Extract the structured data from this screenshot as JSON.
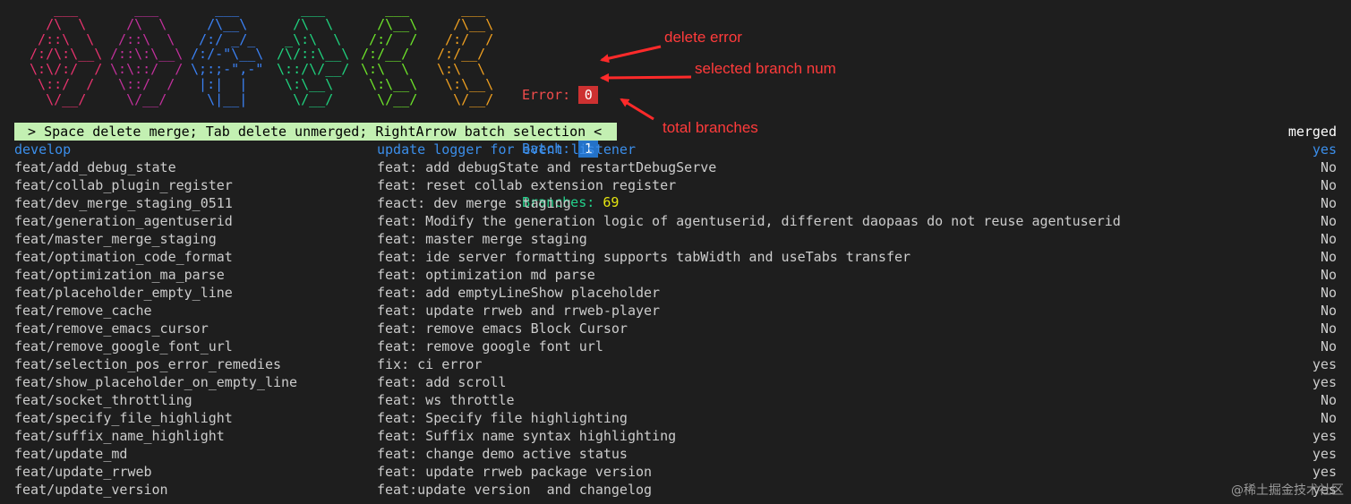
{
  "logo": {
    "columns": [
      {
        "color": "#e8336e",
        "lines": [
          "    ___   ",
          "   /\\  \\  ",
          "  /::\\  \\ ",
          " /:/\\:\\__\\",
          " \\:\\/:/  /",
          "  \\::/  / ",
          "   \\/__/  "
        ]
      },
      {
        "color": "#c2309c",
        "lines": [
          "    ___   ",
          "   /\\  \\  ",
          "  /::\\  \\ ",
          " /::\\:\\__\\",
          " \\:\\::/  /",
          "  \\::/  / ",
          "   \\/__/  "
        ]
      },
      {
        "color": "#3b82f6",
        "lines": [
          "    ___   ",
          "   /\\__\\  ",
          "  /:/ _/_ ",
          " /:/-\"\\__\\",
          " \\;:;-\",-\"",
          "  |:|  |  ",
          "   \\|__|  "
        ]
      },
      {
        "color": "#1fd37f",
        "lines": [
          "    ___   ",
          "   /\\  \\  ",
          "  _\\:\\  \\ ",
          " /\\/::\\__\\",
          " \\::/\\/__/",
          "  \\:\\__\\  ",
          "   \\/__/  "
        ]
      },
      {
        "color": "#6ee62a",
        "lines": [
          "    ___   ",
          "   /\\__\\  ",
          "  /:/  /  ",
          " /:/__/   ",
          " \\:\\  \\   ",
          "  \\:\\__\\  ",
          "   \\/__/  "
        ]
      },
      {
        "color": "#f0a020",
        "lines": [
          "    ___   ",
          "   /\\__\\  ",
          "  /:/  /  ",
          " /:/__/   ",
          " \\:\\  \\   ",
          "  \\:\\__\\  ",
          "   \\/__/  "
        ]
      }
    ]
  },
  "stats": {
    "error_label": "Error: ",
    "error_value": "0",
    "batch_label": "Batch: ",
    "batch_value": "1",
    "branches_label": "Branches: ",
    "branches_value": "69"
  },
  "annotations": {
    "delete_error": "delete error",
    "selected_branch_num": "selected branch num",
    "total_branches": "total branches",
    "color": "#ff3b3b"
  },
  "help_bar": " > Space delete merge; Tab delete unmerged; RightArrow batch selection < ",
  "columns": {
    "merged_header": "merged"
  },
  "rows": [
    {
      "branch": "develop",
      "message": "update logger for event listener",
      "merged": "yes",
      "selected": true
    },
    {
      "branch": "feat/add_debug_state",
      "message": "feat: add debugState and restartDebugServe",
      "merged": "No"
    },
    {
      "branch": "feat/collab_plugin_register",
      "message": "feat: reset collab extension register",
      "merged": "No"
    },
    {
      "branch": "feat/dev_merge_staging_0511",
      "message": "feact: dev merge staging",
      "merged": "No"
    },
    {
      "branch": "feat/generation_agentuserid",
      "message": "feat: Modify the generation logic of agentuserid, different daopaas do not reuse agentuserid",
      "merged": "No"
    },
    {
      "branch": "feat/master_merge_staging",
      "message": "feat: master merge staging",
      "merged": "No"
    },
    {
      "branch": "feat/optimation_code_format",
      "message": "feat: ide server formatting supports tabWidth and useTabs transfer",
      "merged": "No"
    },
    {
      "branch": "feat/optimization_ma_parse",
      "message": "feat: optimization md parse",
      "merged": "No"
    },
    {
      "branch": "feat/placeholder_empty_line",
      "message": "feat: add emptyLineShow placeholder",
      "merged": "No"
    },
    {
      "branch": "feat/remove_cache",
      "message": "feat: update rrweb and rrweb-player",
      "merged": "No"
    },
    {
      "branch": "feat/remove_emacs_cursor",
      "message": "feat: remove emacs Block Cursor",
      "merged": "No"
    },
    {
      "branch": "feat/remove_google_font_url",
      "message": "feat: remove google font url",
      "merged": "No"
    },
    {
      "branch": "feat/selection_pos_error_remedies",
      "message": "fix: ci error",
      "merged": "yes"
    },
    {
      "branch": "feat/show_placeholder_on_empty_line",
      "message": "feat: add scroll",
      "merged": "yes"
    },
    {
      "branch": "feat/socket_throttling",
      "message": "feat: ws throttle",
      "merged": "No"
    },
    {
      "branch": "feat/specify_file_highlight",
      "message": "feat: Specify file highlighting",
      "merged": "No"
    },
    {
      "branch": "feat/suffix_name_highlight",
      "message": "feat: Suffix name syntax highlighting",
      "merged": "yes"
    },
    {
      "branch": "feat/update_md",
      "message": "feat: change demo active status",
      "merged": "yes"
    },
    {
      "branch": "feat/update_rrweb",
      "message": "feat: update rrweb package version",
      "merged": "yes"
    },
    {
      "branch": "feat/update_version",
      "message": "feat:update version  and changelog",
      "merged": "yes"
    }
  ],
  "watermark": "@稀土掘金技术社区"
}
